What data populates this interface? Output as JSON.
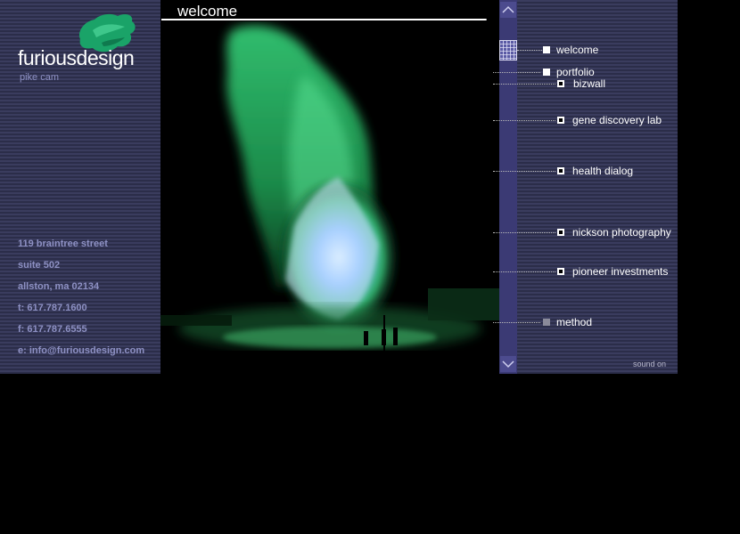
{
  "brand": {
    "name": "furiousdesign",
    "subtitle": "pike cam",
    "splash_color": "#1fa76a"
  },
  "contact": {
    "lines": [
      "119 braintree street",
      "suite 502",
      "allston, ma 02134",
      "t: 617.787.1600",
      "f: 617.787.6555",
      "e: info@furiousdesign.com"
    ],
    "color": "#8e91c4"
  },
  "page": {
    "title": "welcome"
  },
  "nav": {
    "items": [
      {
        "label": "welcome",
        "bullet": "solid"
      },
      {
        "label": "portfolio",
        "bullet": "solid"
      },
      {
        "label": "bizwall",
        "bullet": "hollow"
      },
      {
        "label": "gene discovery lab",
        "bullet": "hollow"
      },
      {
        "label": "health dialog",
        "bullet": "hollow"
      },
      {
        "label": "nickson photography",
        "bullet": "hollow"
      },
      {
        "label": "pioneer investments",
        "bullet": "hollow"
      },
      {
        "label": "method",
        "bullet": "grey"
      }
    ]
  },
  "scrollbar": {
    "up_icon": "chevron-up-icon",
    "down_icon": "chevron-down-icon",
    "color": "#3b3a74"
  },
  "sound": {
    "label": "sound on"
  },
  "photo": {
    "subject": "green-fire-image",
    "accent_color": "#2dd870"
  }
}
